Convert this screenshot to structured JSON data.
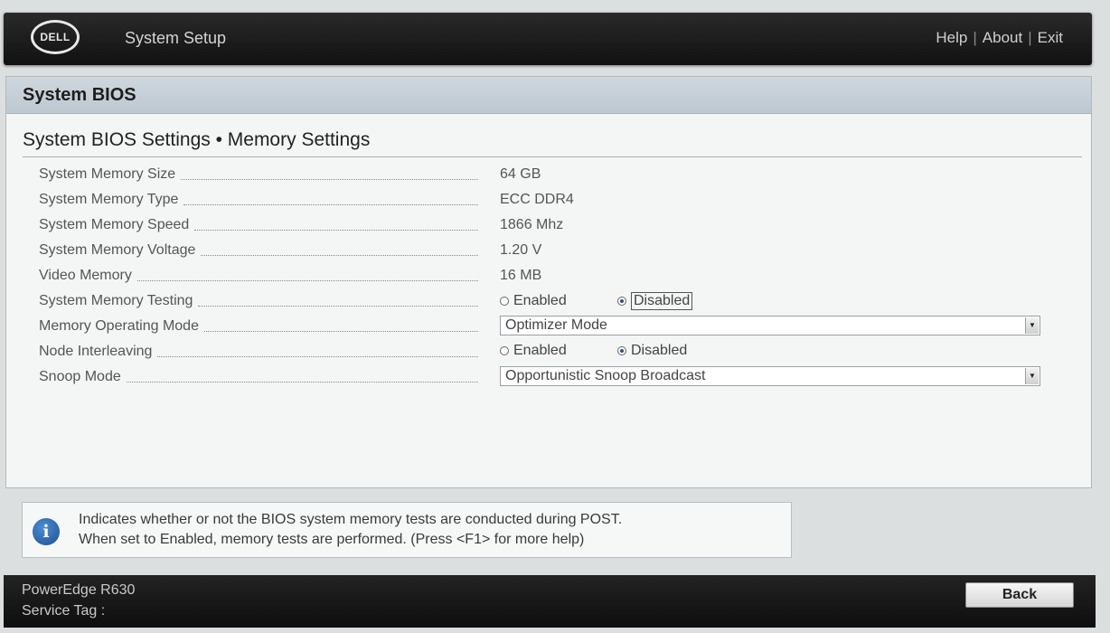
{
  "header": {
    "logo_text": "DELL",
    "title": "System Setup",
    "links": [
      "Help",
      "About",
      "Exit"
    ]
  },
  "panel": {
    "title": "System BIOS",
    "subtitle": "System BIOS Settings • Memory Settings"
  },
  "settings": [
    {
      "label": "System Memory Size",
      "value": "64 GB"
    },
    {
      "label": "System Memory Type",
      "value": "ECC DDR4"
    },
    {
      "label": "System Memory Speed",
      "value": "1866 Mhz"
    },
    {
      "label": "System Memory Voltage",
      "value": "1.20 V"
    },
    {
      "label": "Video Memory",
      "value": "16 MB"
    },
    {
      "label": "System Memory Testing",
      "options": [
        "Enabled",
        "Disabled"
      ],
      "selected": "Disabled"
    },
    {
      "label": "Memory Operating Mode",
      "value": "Optimizer Mode"
    },
    {
      "label": "Node Interleaving",
      "options": [
        "Enabled",
        "Disabled"
      ],
      "selected": "Disabled"
    },
    {
      "label": "Snoop Mode",
      "value": "Opportunistic Snoop Broadcast"
    }
  ],
  "help": {
    "line1": "Indicates whether or not the BIOS system memory tests are conducted during POST.",
    "line2": "When set to Enabled, memory tests are performed. (Press <F1> for more help)"
  },
  "footer": {
    "model": "PowerEdge R630",
    "service_tag_label": "Service Tag :",
    "back_label": "Back"
  },
  "icons": {
    "info": "info-icon",
    "dropdown": "chevron-down-icon"
  },
  "colors": {
    "header_bg": "#1a1a1a",
    "panel_header": "#c6d0d8",
    "radio_selected": "#2e4d8a"
  }
}
